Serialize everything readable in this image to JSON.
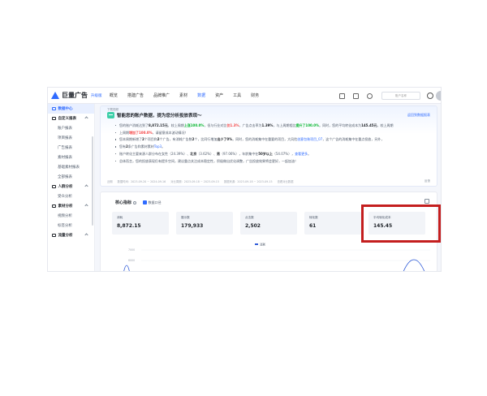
{
  "topbar": {
    "logo": "巨量广告",
    "badge": "升级版",
    "nav": [
      "概览",
      "搭建广告",
      "品牌推广",
      "素材",
      "数据",
      "资产",
      "工具",
      "财务"
    ],
    "active_nav": "数据",
    "account": "账户名称"
  },
  "sidebar": {
    "items": [
      {
        "label": "数据中心",
        "type": "active"
      },
      {
        "label": "自定义报表",
        "type": "group"
      },
      {
        "label": "账户报表",
        "type": "item"
      },
      {
        "label": "项目报表",
        "type": "item"
      },
      {
        "label": "广告报表",
        "type": "item"
      },
      {
        "label": "素材报表",
        "type": "item"
      },
      {
        "label": "基础素材报表",
        "type": "item"
      },
      {
        "label": "全部报表",
        "type": "item"
      },
      {
        "label": "人群分析",
        "type": "group"
      },
      {
        "label": "受众分析",
        "type": "item"
      },
      {
        "label": "素材分析",
        "type": "group"
      },
      {
        "label": "视频分析",
        "type": "item"
      },
      {
        "label": "标签分析",
        "type": "item"
      },
      {
        "label": "流量分析",
        "type": "group"
      }
    ]
  },
  "insight": {
    "tag": "下载视频",
    "title": "智能您的账户数据，提为您分析投放表现～",
    "link": "返回到数据报表",
    "feedback": "反馈",
    "footer": [
      "近期",
      "数据时间：2023-09-20 ~ 2024-09-16",
      "对比周期：2023-09-18 ~ 2023-09-15",
      "数据来源：2023-09-18 ~ 2023-09-15",
      "查看对比数据"
    ],
    "bullets": [
      {
        "parts": [
          {
            "t": "您的账户消耗达到了"
          },
          {
            "t": "8,872.15元",
            "c": "bold"
          },
          {
            "t": "，较上周期"
          },
          {
            "t": "上涨100.0%",
            "c": "hl-g"
          },
          {
            "t": "，但与行业对比"
          },
          {
            "t": "仅1.3%",
            "c": "hl-r"
          },
          {
            "t": "，广告点击率为"
          },
          {
            "t": "1.39%",
            "c": "bold"
          },
          {
            "t": "，与上周期相比"
          },
          {
            "t": "提升了100.0%",
            "c": "hl-g"
          },
          {
            "t": "。同时，您的平均转化成本为"
          },
          {
            "t": "145.45元",
            "c": "bold"
          },
          {
            "t": "，较上周期"
          }
        ]
      },
      {
        "parts": [
          {
            "t": "上周期"
          },
          {
            "t": "增加了100.0%",
            "c": "hl-r"
          },
          {
            "t": "，请留意成本波动情况！"
          }
        ]
      },
      {
        "parts": [
          {
            "t": "您本周期新增了"
          },
          {
            "t": "2",
            "c": "bold"
          },
          {
            "t": "个项目和"
          },
          {
            "t": "2",
            "c": "bold"
          },
          {
            "t": "个广告，有消耗广告数"
          },
          {
            "t": "2",
            "c": "bold"
          },
          {
            "t": "个，比同行增加"
          },
          {
            "t": "出少了0%",
            "c": "bold"
          },
          {
            "t": "。同时，您的消耗集中在重要的项目，大风险"
          },
          {
            "t": "创意包装项目_07",
            "c": "hl-b"
          },
          {
            "t": "，这个广告的消耗集中在重点投放，另外，"
          }
        ]
      },
      {
        "parts": [
          {
            "t": "您有"
          },
          {
            "t": "2",
            "c": "bold"
          },
          {
            "t": "条广告和素材素材"
          },
          {
            "t": "Top3",
            "c": "hl-b"
          },
          {
            "t": "。"
          }
        ]
      },
      {
        "parts": [
          {
            "t": "账户转化主要来源人群分布在女性（24.39%）、"
          },
          {
            "t": "北京",
            "c": "bold"
          },
          {
            "t": "（3.62%）、"
          },
          {
            "t": "男",
            "c": "bold"
          },
          {
            "t": "（97.06%），年龄集中在"
          },
          {
            "t": "50岁以上",
            "c": "bold"
          },
          {
            "t": "（54.07%），"
          },
          {
            "t": "查看更多",
            "c": "hl-b"
          },
          {
            "t": "。"
          }
        ]
      },
      {
        "parts": [
          {
            "t": "总体而言，您的投放表现仍有提升空间，建议重点关注成本稳定性，积极做出优化调整，广告投放效果将会更好，一起加油！"
          }
        ]
      }
    ]
  },
  "metrics": {
    "title": "核心指标",
    "sub": "数据口径",
    "kpis": [
      {
        "label": "消耗",
        "value": "8,872.15"
      },
      {
        "label": "展示数",
        "value": "179,933"
      },
      {
        "label": "点击数",
        "value": "2,502"
      },
      {
        "label": "转化数",
        "value": "61"
      },
      {
        "label": "平均转化成本",
        "value": "145.45"
      }
    ],
    "chart_legend": "消耗",
    "chart_ticks": [
      "7000",
      "6000"
    ]
  }
}
